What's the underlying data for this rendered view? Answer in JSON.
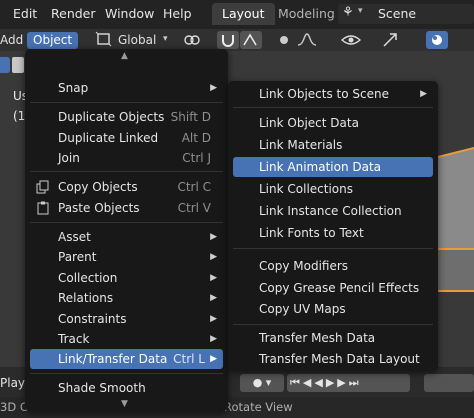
{
  "topbar": {
    "menus": [
      "Edit",
      "Render",
      "Window",
      "Help"
    ],
    "workspace_tabs": [
      "Layout",
      "Modeling"
    ],
    "scene_label": "Scene"
  },
  "header": {
    "add_label": "Add",
    "object_label": "Object",
    "orientation": "Global"
  },
  "viewport": {
    "overlay_line1": "Us",
    "overlay_line2": "(1"
  },
  "object_menu": {
    "items": [
      {
        "label": "Snap",
        "shortcut": "",
        "submenu": true
      },
      {
        "label": "Duplicate Objects",
        "shortcut": "Shift D",
        "submenu": false
      },
      {
        "label": "Duplicate Linked",
        "shortcut": "Alt D",
        "submenu": false
      },
      {
        "label": "Join",
        "shortcut": "Ctrl J",
        "submenu": false
      },
      {
        "label": "Copy Objects",
        "shortcut": "Ctrl C",
        "submenu": false,
        "icon": "copy-icon"
      },
      {
        "label": "Paste Objects",
        "shortcut": "Ctrl V",
        "submenu": false,
        "icon": "paste-icon"
      },
      {
        "label": "Asset",
        "shortcut": "",
        "submenu": true
      },
      {
        "label": "Parent",
        "shortcut": "",
        "submenu": true
      },
      {
        "label": "Collection",
        "shortcut": "",
        "submenu": true
      },
      {
        "label": "Relations",
        "shortcut": "",
        "submenu": true
      },
      {
        "label": "Constraints",
        "shortcut": "",
        "submenu": true
      },
      {
        "label": "Track",
        "shortcut": "",
        "submenu": true
      },
      {
        "label": "Link/Transfer Data",
        "shortcut": "Ctrl L",
        "submenu": true,
        "highlighted": true
      },
      {
        "label": "Shade Smooth",
        "shortcut": "",
        "submenu": false
      }
    ]
  },
  "link_menu": {
    "items": [
      {
        "label": "Link Objects to Scene",
        "submenu": true
      },
      {
        "label": "Link Object Data"
      },
      {
        "label": "Link Materials"
      },
      {
        "label": "Link Animation Data",
        "highlighted": true
      },
      {
        "label": "Link Collections"
      },
      {
        "label": "Link Instance Collection"
      },
      {
        "label": "Link Fonts to Text"
      },
      {
        "label": "Copy Modifiers"
      },
      {
        "label": "Copy Grease Pencil Effects"
      },
      {
        "label": "Copy UV Maps"
      },
      {
        "label": "Transfer Mesh Data"
      },
      {
        "label": "Transfer Mesh Data Layout"
      }
    ]
  },
  "timeline": {
    "playback_label": "Playb"
  },
  "statusbar": {
    "left": "3D C",
    "rotate": "Rotate View"
  },
  "colors": {
    "accent": "#4772b3",
    "selection_outline": "#e99a3b",
    "menu_bg": "#181818"
  }
}
